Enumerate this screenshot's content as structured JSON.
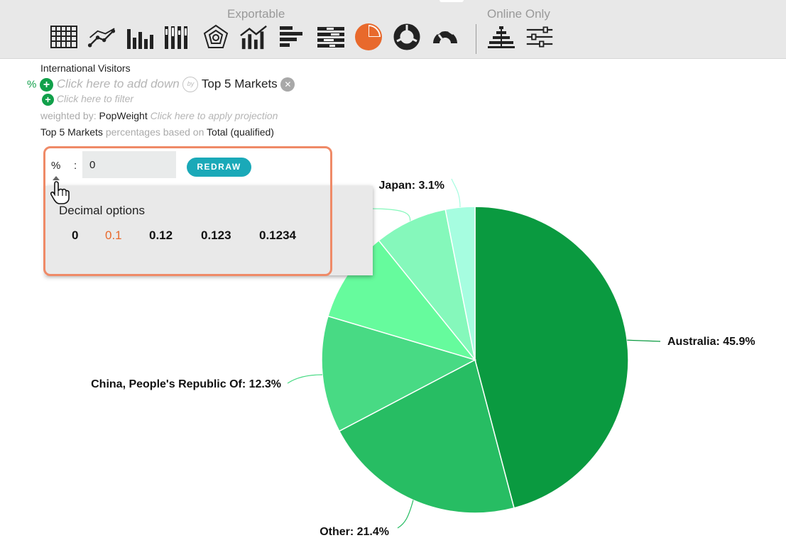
{
  "toolbar": {
    "exportable_label": "Exportable",
    "online_only_label": "Online Only",
    "tools": [
      {
        "name": "table-icon"
      },
      {
        "name": "line-chart-icon"
      },
      {
        "name": "bar-chart-icon"
      },
      {
        "name": "stacked-bar-icon"
      },
      {
        "name": "radar-chart-icon"
      },
      {
        "name": "bar-line-combo-icon"
      },
      {
        "name": "horizontal-bar-icon"
      },
      {
        "name": "horizontal-stacked-bar-icon"
      },
      {
        "name": "pie-chart-icon",
        "active": true
      },
      {
        "name": "donut-chart-icon"
      },
      {
        "name": "gauge-icon"
      },
      {
        "name": "pyramid-icon"
      },
      {
        "name": "sliders-icon"
      }
    ],
    "active_color": "#e8692c"
  },
  "query": {
    "title": "International Visitors",
    "pct_symbol": "%",
    "add_down_placeholder": "Click here to add down",
    "by_label": "by",
    "banner": "Top 5 Markets",
    "filter_placeholder": "Click here to filter",
    "weighted_prefix": "weighted by:",
    "weight_name": "PopWeight",
    "projection_placeholder": "Click here to apply projection",
    "base_banner": "Top 5 Markets",
    "base_middle": "percentages based on",
    "base_name": "Total (qualified)"
  },
  "decimal_editor": {
    "symbol": "%",
    "colon": ":",
    "value": "0",
    "redraw_label": "REDRAW",
    "options_title": "Decimal options",
    "options": [
      "0",
      "0.1",
      "0.12",
      "0.123",
      "0.1234"
    ],
    "selected_index": 1
  },
  "chart_data": {
    "type": "pie",
    "slices": [
      {
        "label": "Australia",
        "value": 45.9,
        "display": "Australia: 45.9%",
        "color": "#0a9a40"
      },
      {
        "label": "Other",
        "value": 21.4,
        "display": "Other: 21.4%",
        "color": "#27bd63"
      },
      {
        "label": "China, People's Republic Of",
        "value": 12.3,
        "display": "China, People's Republic Of: 12.3%",
        "color": "#48da84"
      },
      {
        "label": "",
        "value": 9.6,
        "display": "",
        "color": "#66fb9d"
      },
      {
        "label": "",
        "value": 7.7,
        "display": "",
        "color": "#85f8bb"
      },
      {
        "label": "Japan",
        "value": 3.1,
        "display": "Japan: 3.1%",
        "color": "#a6fde0"
      }
    ],
    "start": "12 o'clock",
    "direction": "clockwise"
  }
}
